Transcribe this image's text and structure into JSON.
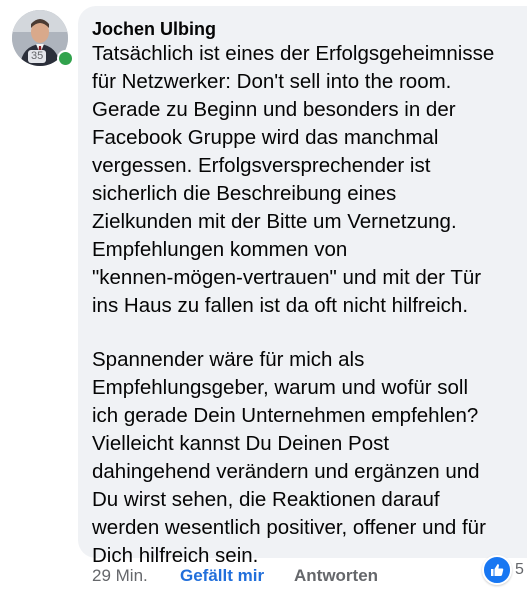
{
  "comment": {
    "author": "Jochen Ulbing",
    "avatar_badge": "35",
    "online": true,
    "paragraph_1": "Tatsächlich ist eines der Erfolgsgeheimnisse\nfür Netzwerker: Don't sell into the room.\nGerade zu Beginn und besonders in der\nFacebook Gruppe wird das manchmal\nvergessen. Erfolgsversprechender ist\nsicherlich die Beschreibung eines\nZielkunden mit der Bitte um Vernetzung.\nEmpfehlungen kommen von\n\"kennen-mögen-vertrauen\" und mit der Tür\nins Haus zu fallen ist da oft nicht hilfreich.",
    "paragraph_2": "Spannender wäre für mich als\nEmpfehlungsgeber, warum und wofür soll\nich gerade Dein Unternehmen empfehlen?\nVielleicht kannst Du Deinen Post\ndahingehend verändern und ergänzen und\nDu wirst sehen, die Reaktionen darauf\nwerden wesentlich positiver, offener und für\nDich hilfreich sein."
  },
  "actions": {
    "time": "29 Min.",
    "like_label": "Gefällt mir",
    "reply_label": "Antworten"
  },
  "reactions": {
    "icon": "thumbs-up-icon",
    "count": "5"
  },
  "colors": {
    "bubble": "#f0f2f5",
    "like_blue": "#216fdb",
    "online_green": "#31a24c",
    "muted": "#65676b"
  }
}
